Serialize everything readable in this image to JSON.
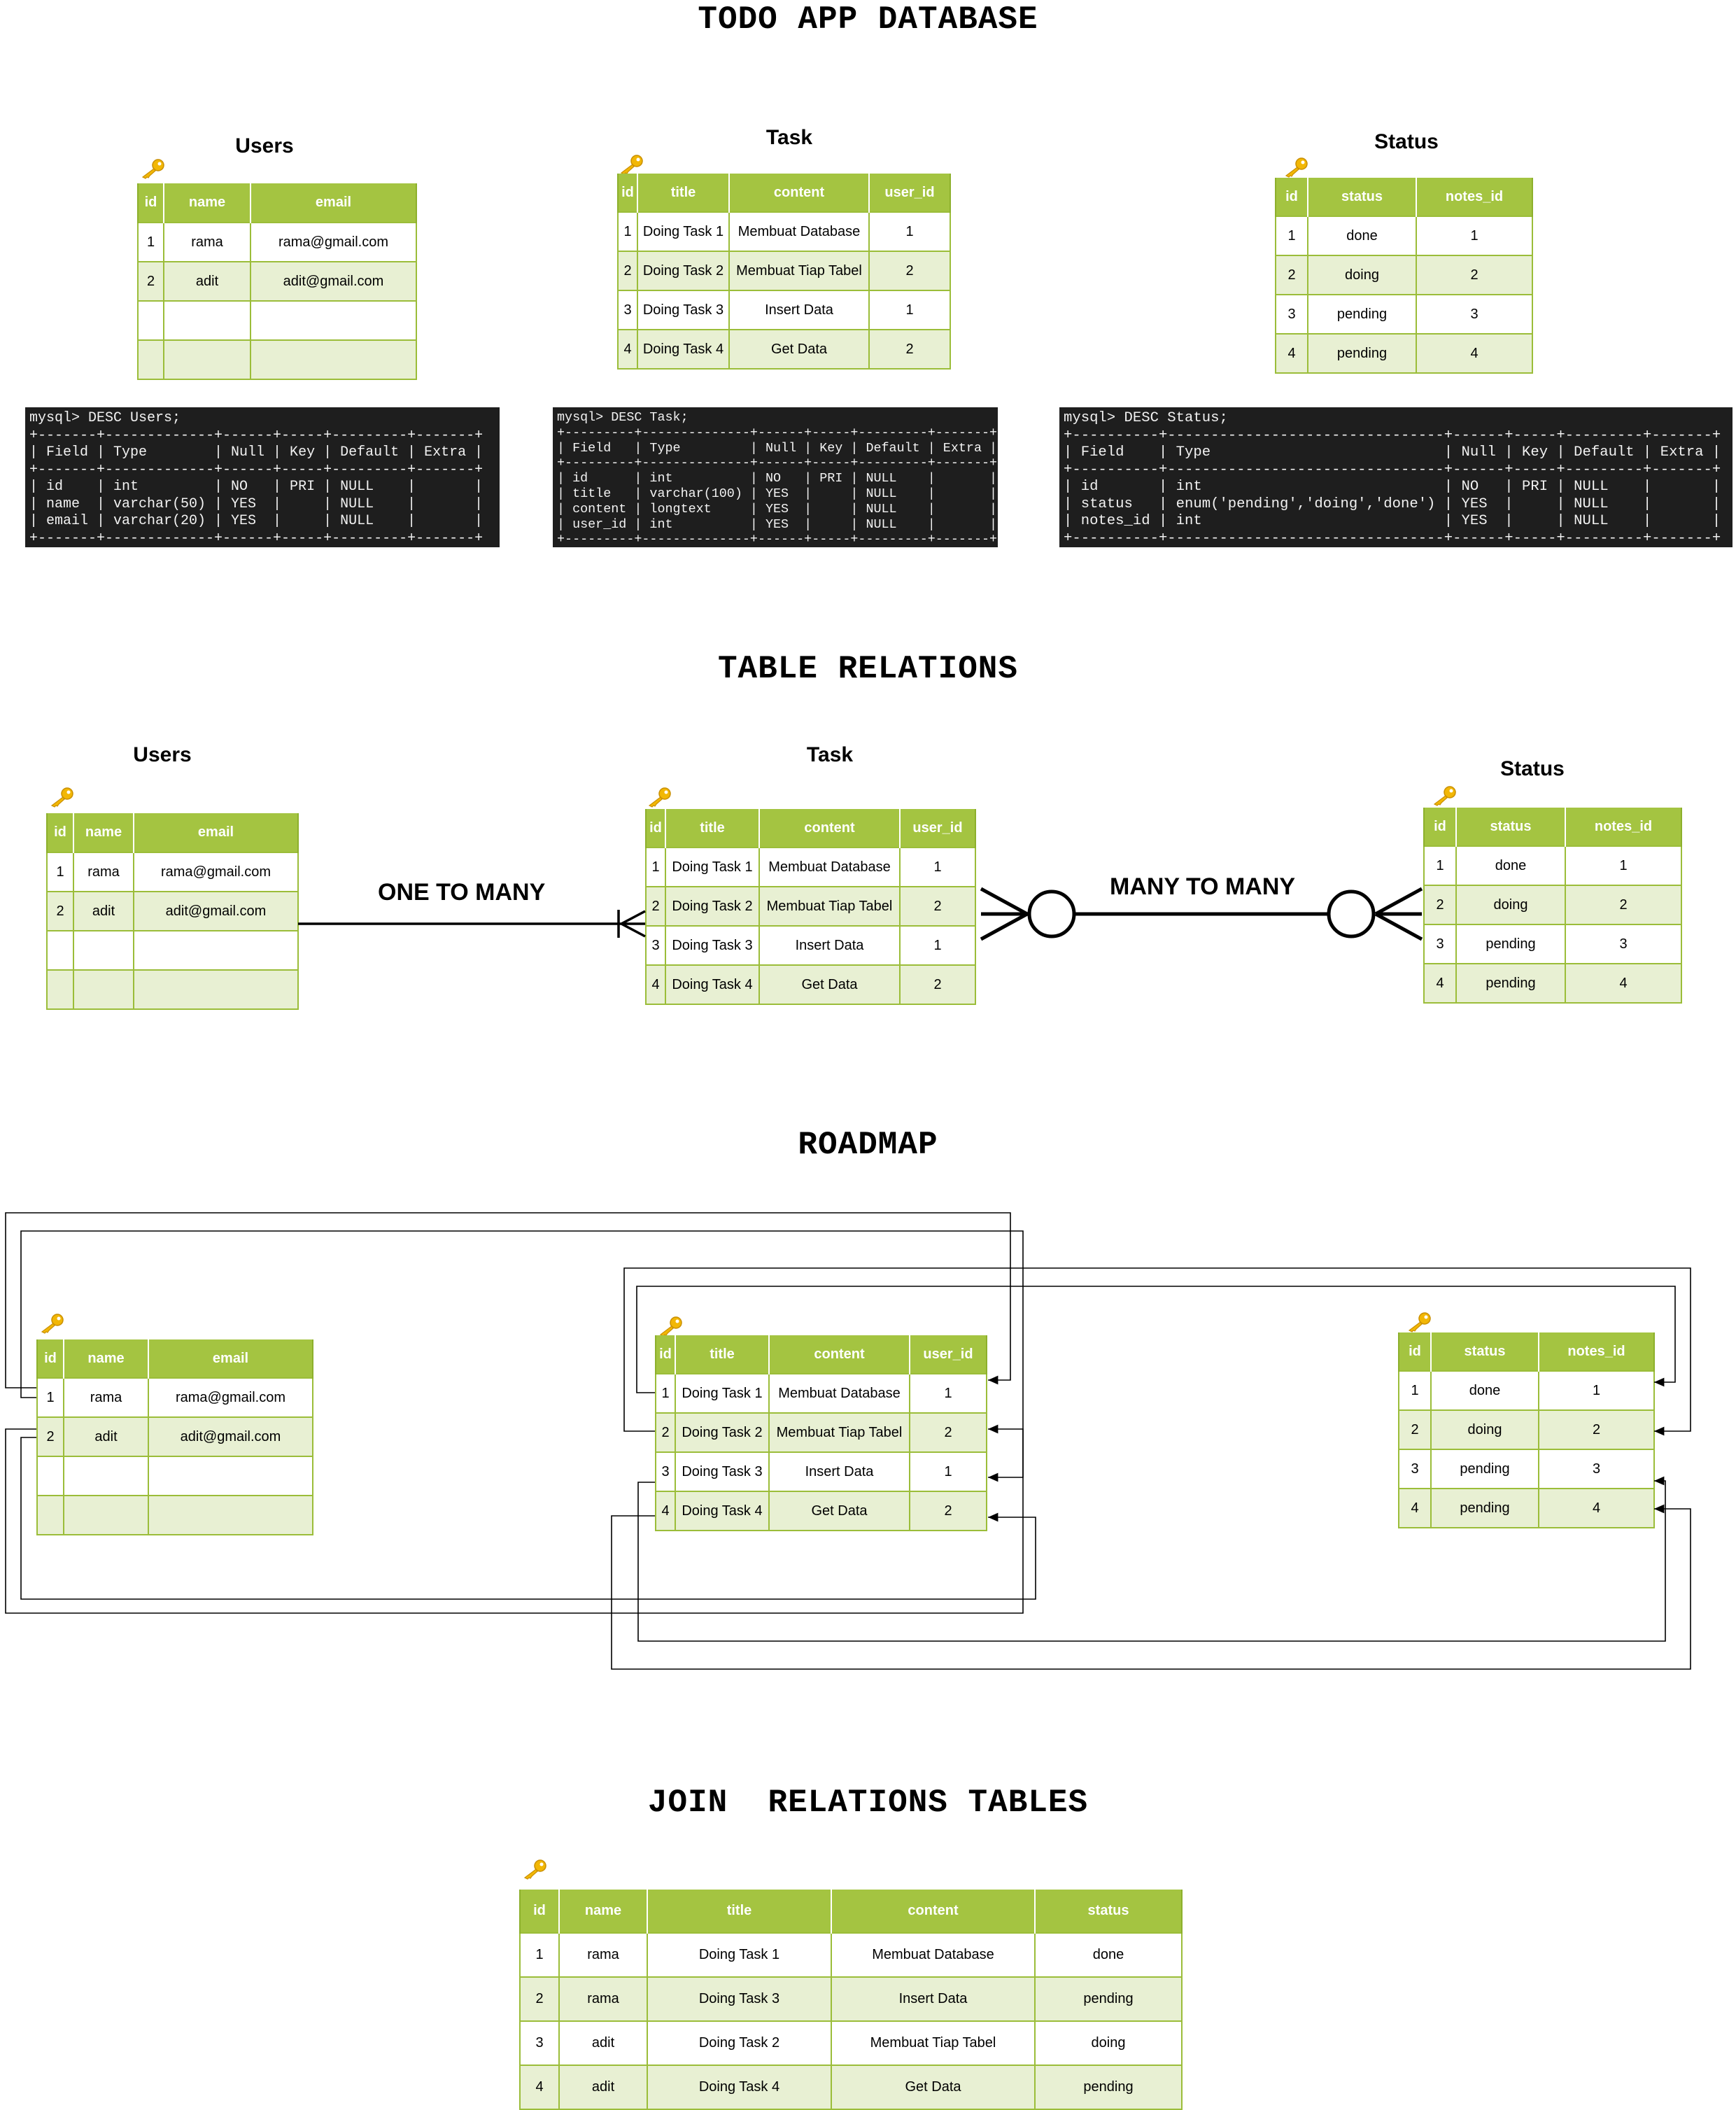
{
  "headings": {
    "main": "TODO APP DATABASE",
    "relations": "TABLE RELATIONS",
    "roadmap": "ROADMAP",
    "join": "JOIN  RELATIONS TABLES"
  },
  "captions": {
    "users": "Users",
    "task": "Task",
    "status": "Status"
  },
  "relation_labels": {
    "one_to_many": "ONE TO MANY",
    "many_to_many": "MANY TO MANY"
  },
  "tables": {
    "users": {
      "columns": [
        "id",
        "name",
        "email"
      ],
      "rows": [
        [
          "1",
          "rama",
          "rama@gmail.com"
        ],
        [
          "2",
          "adit",
          "adit@gmail.com"
        ],
        [
          "",
          "",
          ""
        ],
        [
          "",
          "",
          ""
        ]
      ]
    },
    "task": {
      "columns": [
        "id",
        "title",
        "content",
        "user_id"
      ],
      "rows": [
        [
          "1",
          "Doing Task 1",
          "Membuat Database",
          "1"
        ],
        [
          "2",
          "Doing Task 2",
          "Membuat Tiap Tabel",
          "2"
        ],
        [
          "3",
          "Doing Task 3",
          "Insert Data",
          "1"
        ],
        [
          "4",
          "Doing Task 4",
          "Get Data",
          "2"
        ]
      ]
    },
    "status": {
      "columns": [
        "id",
        "status",
        "notes_id"
      ],
      "rows": [
        [
          "1",
          "done",
          "1"
        ],
        [
          "2",
          "doing",
          "2"
        ],
        [
          "3",
          "pending",
          "3"
        ],
        [
          "4",
          "pending",
          "4"
        ]
      ]
    },
    "join": {
      "columns": [
        "id",
        "name",
        "title",
        "content",
        "status"
      ],
      "rows": [
        [
          "1",
          "rama",
          "Doing Task 1",
          "Membuat Database",
          "done"
        ],
        [
          "2",
          "rama",
          "Doing Task 3",
          "Insert Data",
          "pending"
        ],
        [
          "3",
          "adit",
          "Doing Task 2",
          "Membuat Tiap Tabel",
          "doing"
        ],
        [
          "4",
          "adit",
          "Doing Task 4",
          "Get Data",
          "pending"
        ]
      ]
    }
  },
  "terminals": {
    "users": [
      "mysql> DESC Users;",
      "+-------+-------------+------+-----+---------+-------+",
      "| Field | Type        | Null | Key | Default | Extra |",
      "+-------+-------------+------+-----+---------+-------+",
      "| id    | int         | NO   | PRI | NULL    |       |",
      "| name  | varchar(50) | YES  |     | NULL    |       |",
      "| email | varchar(20) | YES  |     | NULL    |       |",
      "+-------+-------------+------+-----+---------+-------+"
    ],
    "task": [
      "mysql> DESC Task;",
      "+---------+--------------+------+-----+---------+-------+",
      "| Field   | Type         | Null | Key | Default | Extra |",
      "+---------+--------------+------+-----+---------+-------+",
      "| id      | int          | NO   | PRI | NULL    |       |",
      "| title   | varchar(100) | YES  |     | NULL    |       |",
      "| content | longtext     | YES  |     | NULL    |       |",
      "| user_id | int          | YES  |     | NULL    |       |",
      "+---------+--------------+------+-----+---------+-------+"
    ],
    "status": [
      "mysql> DESC Status;",
      "+----------+--------------------------------+------+-----+---------+-------+",
      "| Field    | Type                           | Null | Key | Default | Extra |",
      "+----------+--------------------------------+------+-----+---------+-------+",
      "| id       | int                            | NO   | PRI | NULL    |       |",
      "| status   | enum('pending','doing','done') | YES  |     | NULL    |       |",
      "| notes_id | int                            | YES  |     | NULL    |       |",
      "+----------+--------------------------------+------+-----+---------+-------+"
    ]
  },
  "icons": {
    "primary_key": "key-icon",
    "one_to_many_end": "crow-foot-one-to-many-icon",
    "many_to_many_end": "crow-foot-zero-or-many-icon"
  },
  "colors": {
    "table_header": "#a4c441",
    "table_border": "#9bbd39",
    "row_alt": "#e8f0d3",
    "terminal_bg": "#1e1e1e",
    "key": "#f2b705"
  }
}
